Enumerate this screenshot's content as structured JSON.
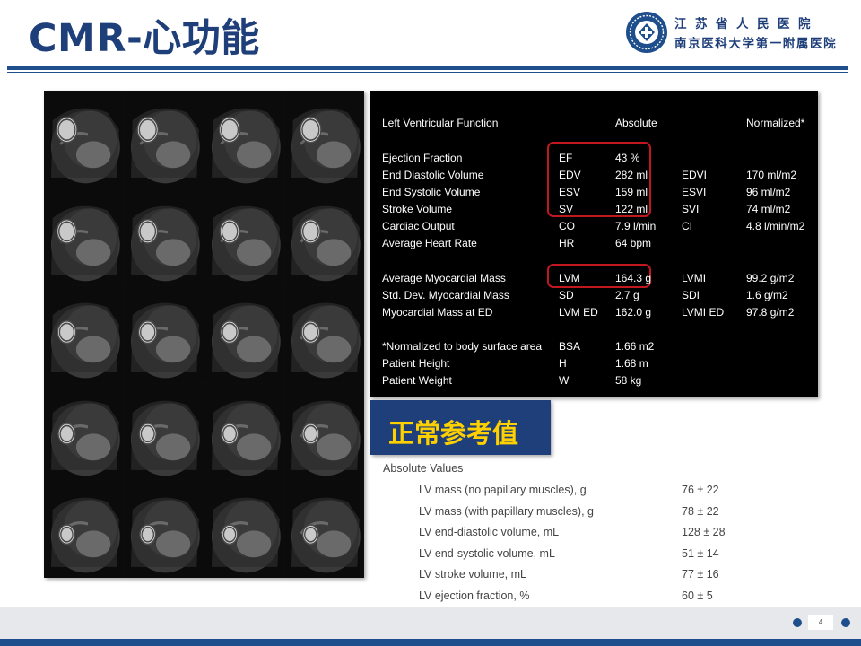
{
  "slide": {
    "title": "CMR-心功能",
    "page_number": "4"
  },
  "header": {
    "hospital_name_line1": "江苏省人民医院",
    "hospital_name_line2": "南京医科大学第一附属医院",
    "logo_icon": "hospital-logo-icon",
    "brand_color": "#1f3f7a"
  },
  "mri_panel": {
    "icon": "cardiac-mri-short-axis-grid",
    "rows": 5,
    "columns": 4
  },
  "lv_function": {
    "header": {
      "label": "Left Ventricular Function",
      "absolute": "Absolute",
      "normalized": "Normalized*"
    },
    "rows": [
      {
        "label": "Ejection Fraction",
        "abbr": "EF",
        "value": "43 %",
        "n_abbr": "",
        "n_value": ""
      },
      {
        "label": "End Diastolic Volume",
        "abbr": "EDV",
        "value": "282 ml",
        "n_abbr": "EDVI",
        "n_value": "170 ml/m2"
      },
      {
        "label": "End Systolic Volume",
        "abbr": "ESV",
        "value": "159 ml",
        "n_abbr": "ESVI",
        "n_value": "96 ml/m2"
      },
      {
        "label": "Stroke Volume",
        "abbr": "SV",
        "value": "122 ml",
        "n_abbr": "SVI",
        "n_value": "74 ml/m2"
      },
      {
        "label": "Cardiac Output",
        "abbr": "CO",
        "value": "7.9 l/min",
        "n_abbr": "CI",
        "n_value": "4.8 l/min/m2"
      },
      {
        "label": "Average Heart Rate",
        "abbr": "HR",
        "value": "64 bpm",
        "n_abbr": "",
        "n_value": ""
      },
      {
        "label": "Average Myocardial Mass",
        "abbr": "LVM",
        "value": "164.3 g",
        "n_abbr": "LVMI",
        "n_value": "99.2 g/m2"
      },
      {
        "label": "Std. Dev. Myocardial Mass",
        "abbr": "SD",
        "value": "2.7 g",
        "n_abbr": "SDI",
        "n_value": "1.6 g/m2"
      },
      {
        "label": "Myocardial Mass at ED",
        "abbr": "LVM ED",
        "value": "162.0 g",
        "n_abbr": "LVMI ED",
        "n_value": "97.8 g/m2"
      },
      {
        "label": "*Normalized to body surface area",
        "abbr": "BSA",
        "value": "1.66 m2",
        "n_abbr": "",
        "n_value": ""
      },
      {
        "label": "Patient Height",
        "abbr": "H",
        "value": "1.68 m",
        "n_abbr": "",
        "n_value": ""
      },
      {
        "label": "Patient Weight",
        "abbr": "W",
        "value": "58 kg",
        "n_abbr": "",
        "n_value": ""
      }
    ],
    "highlight_color": "#c0181e"
  },
  "normal_reference": {
    "badge_label": "正常参考值",
    "badge_color": "#1f3f7a",
    "badge_text_color": "#ffd000",
    "section_title": "Absolute Values",
    "rows": [
      {
        "label": "LV mass (no papillary muscles), g",
        "value": "76 ± 22"
      },
      {
        "label": "LV mass (with papillary muscles), g",
        "value": "78 ± 22"
      },
      {
        "label": "LV end-diastolic volume, mL",
        "value": "128 ± 28"
      },
      {
        "label": "LV end-systolic volume, mL",
        "value": "51 ± 14"
      },
      {
        "label": "LV stroke volume, mL",
        "value": "77 ± 16"
      },
      {
        "label": "LV ejection fraction, %",
        "value": "60 ± 5"
      }
    ]
  }
}
